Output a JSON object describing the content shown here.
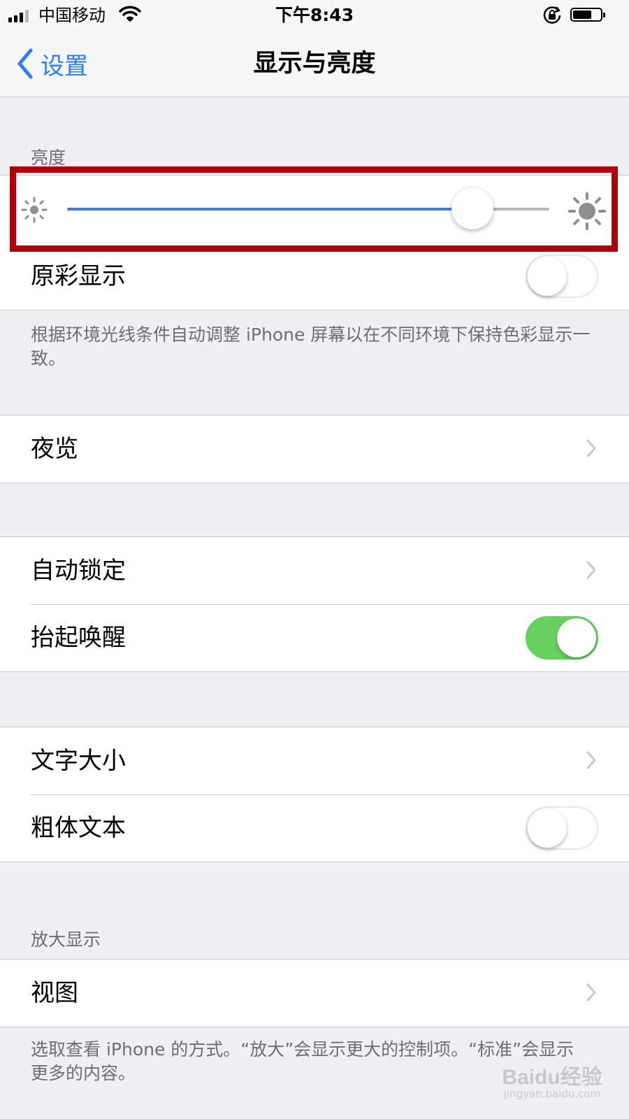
{
  "status_bar": {
    "carrier": "中国移动",
    "time": "下午8:43",
    "signal_bars": 4,
    "signal_bars_filled": 3,
    "battery_level": 0.6,
    "icons": [
      "signal-icon",
      "wifi-icon",
      "orientation-lock-icon",
      "battery-icon"
    ]
  },
  "nav": {
    "back_label": "设置",
    "title": "显示与亮度"
  },
  "brightness": {
    "header": "亮度",
    "value": 0.84
  },
  "true_tone": {
    "label": "原彩显示",
    "on": false,
    "footer": "根据环境光线条件自动调整 iPhone 屏幕以在不同环境下保持色彩显示一致。"
  },
  "night_shift": {
    "label": "夜览"
  },
  "lock_group": {
    "auto_lock_label": "自动锁定",
    "raise_to_wake_label": "抬起唤醒",
    "raise_to_wake_on": true
  },
  "text_group": {
    "text_size_label": "文字大小",
    "bold_text_label": "粗体文本",
    "bold_text_on": false
  },
  "zoom": {
    "header": "放大显示",
    "view_label": "视图",
    "footer": "选取查看 iPhone 的方式。“放大”会显示更大的控制项。“标准”会显示更多的内容。"
  },
  "colors": {
    "accent": "#2f7cf6",
    "slider_fill": "#3b7fe0",
    "toggle_on": "#66d15f",
    "highlight": "#b0000c",
    "background": "#efeff4"
  },
  "watermark": {
    "main": "Baidu经验",
    "sub": "jingyan.baidu.com"
  }
}
